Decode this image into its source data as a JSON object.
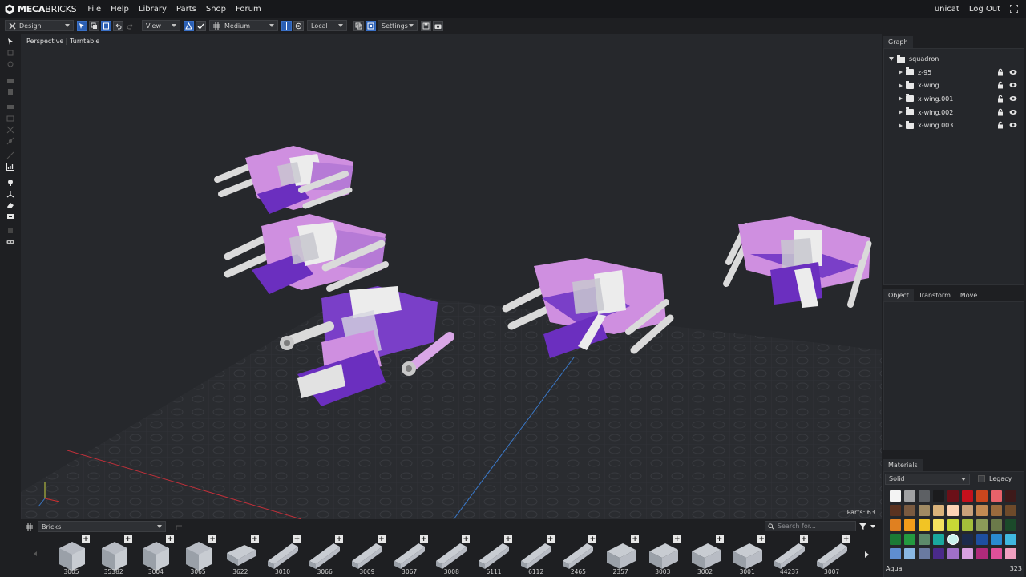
{
  "brand": {
    "name_bold": "MECA",
    "name_rest": "BRICKS"
  },
  "menu": [
    "File",
    "Help",
    "Library",
    "Parts",
    "Shop",
    "Forum"
  ],
  "user": {
    "name": "unicat",
    "logout": "Log Out"
  },
  "toolbar": {
    "mode": "Design",
    "view": "View",
    "quality": "Medium",
    "space": "Local",
    "settings": "Settings"
  },
  "viewport": {
    "label": "Perspective | Turntable",
    "parts_count": "Parts: 63"
  },
  "graph": {
    "tab": "Graph",
    "root": "squadron",
    "children": [
      "z-95",
      "x-wing",
      "x-wing.001",
      "x-wing.002",
      "x-wing.003"
    ]
  },
  "object_tabs": [
    "Object",
    "Transform",
    "Move"
  ],
  "materials": {
    "tab": "Materials",
    "type": "Solid",
    "legacy": "Legacy",
    "selected_name": "Aqua",
    "selected_id": "323",
    "swatches": [
      "#f4f4f4",
      "#a0a1a3",
      "#5d6064",
      "#1b1b1d",
      "#6b1018",
      "#c4101c",
      "#c9461d",
      "#e8626a",
      "#3e1a1a",
      "#5a3220",
      "#7a5a40",
      "#a08a63",
      "#d9b27a",
      "#fcd3b4",
      "#c9a17a",
      "#c28a53",
      "#9a6a3d",
      "#6e4a2a",
      "#e08020",
      "#f39c1a",
      "#f2c424",
      "#f5e15f",
      "#c8d836",
      "#a4bd3a",
      "#8c9a58",
      "#6b7a4a",
      "#1b4a2a",
      "#1b7a35",
      "#249a40",
      "#5d8a6a",
      "#1aa89e",
      "#c8f0ec",
      "#1b2a4a",
      "#1e4fa0",
      "#2a8ad0",
      "#40b8e0",
      "#5f8ed0",
      "#8ab8e4",
      "#6a7aa0",
      "#4a2a8a",
      "#a070c8",
      "#d8a0e0",
      "#b02a7a",
      "#e0509a",
      "#f0a0c0"
    ]
  },
  "parts": {
    "category": "Bricks",
    "search_placeholder": "Search for...",
    "items": [
      "3005",
      "35382",
      "3004",
      "3065",
      "3622",
      "3010",
      "3066",
      "3009",
      "3067",
      "3008",
      "6111",
      "6112",
      "2465",
      "2357",
      "3003",
      "3002",
      "3001",
      "44237",
      "3007"
    ]
  }
}
